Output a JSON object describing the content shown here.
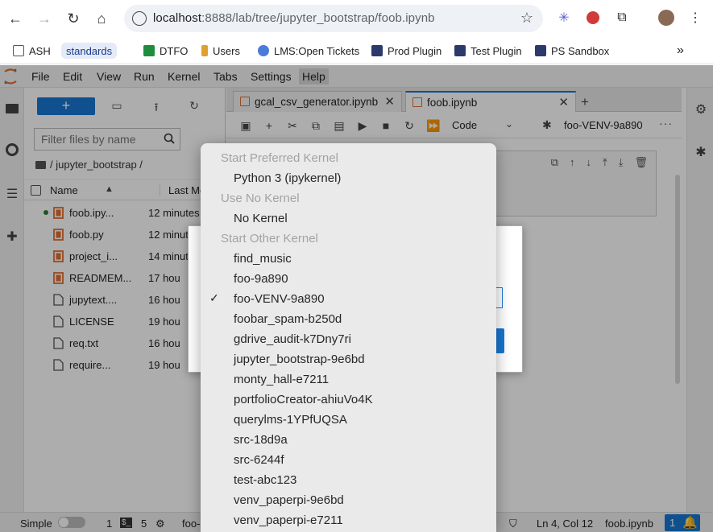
{
  "browser": {
    "url_host": "localhost",
    "url_rest": ":8888/lab/tree/jupyter_bootstrap/foob.ipynb",
    "bookmarks": [
      "ASH",
      "standards",
      "DTFO",
      "Users",
      "LMS:Open Tickets",
      "Prod Plugin",
      "Test Plugin",
      "PS Sandbox"
    ],
    "overflow": "»"
  },
  "menubar": {
    "items": [
      "File",
      "Edit",
      "View",
      "Run",
      "Kernel",
      "Tabs",
      "Settings",
      "Help"
    ]
  },
  "filebrowser": {
    "new_label": "+",
    "filter_placeholder": "Filter files by name",
    "breadcrumb": "/ jupyter_bootstrap /",
    "col_name": "Name",
    "col_modified": "Last Mo",
    "files": [
      {
        "name": "foob.ipy...",
        "modified": "12 minutes",
        "type": "notebook",
        "running": true
      },
      {
        "name": "foob.py",
        "modified": "12 minut",
        "type": "notebook",
        "running": false
      },
      {
        "name": "project_i...",
        "modified": "14 minut",
        "type": "notebook",
        "running": false
      },
      {
        "name": "READMEM...",
        "modified": "17 hou",
        "type": "notebook",
        "running": false
      },
      {
        "name": "jupytext....",
        "modified": "16 hou",
        "type": "file",
        "running": false
      },
      {
        "name": "LICENSE",
        "modified": "19 hou",
        "type": "file",
        "running": false
      },
      {
        "name": "req.txt",
        "modified": "16 hou",
        "type": "file",
        "running": false
      },
      {
        "name": "require...",
        "modified": "19 hou",
        "type": "file",
        "running": false
      }
    ]
  },
  "tabs": [
    {
      "label": "gcal_csv_generator.ipynb",
      "close": "✕"
    },
    {
      "label": "foob.ipynb",
      "close": "✕"
    }
  ],
  "toolbar": {
    "cell_type": "Code",
    "kernel_name": "foo-VENV-9a890"
  },
  "kernel_menu": {
    "sections": [
      {
        "header": "Start Preferred Kernel",
        "items": [
          "Python 3 (ipykernel)"
        ]
      },
      {
        "header": "Use No Kernel",
        "items": [
          "No Kernel"
        ]
      },
      {
        "header": "Start Other Kernel",
        "items": [
          "find_music",
          "foo-9a890",
          "foo-VENV-9a890",
          "foobar_spam-b250d",
          "gdrive_audit-k7Dny7ri",
          "jupyter_bootstrap-9e6bd",
          "monty_hall-e7211",
          "portfolioCreator-ahiuVo4K",
          "querylms-1YPfUQSA",
          "src-18d9a",
          "src-6244f",
          "test-abc123",
          "venv_paperpi-9e6bd",
          "venv_paperpi-e7211"
        ]
      }
    ],
    "selected": "foo-VENV-9a890",
    "check": "✓"
  },
  "statusbar": {
    "mode": "Simple",
    "num1": "1",
    "num2": "5",
    "kernel_short": "foo-",
    "cursor": "Ln 4, Col 12",
    "file": "foob.ipynb",
    "notifications": "1"
  }
}
